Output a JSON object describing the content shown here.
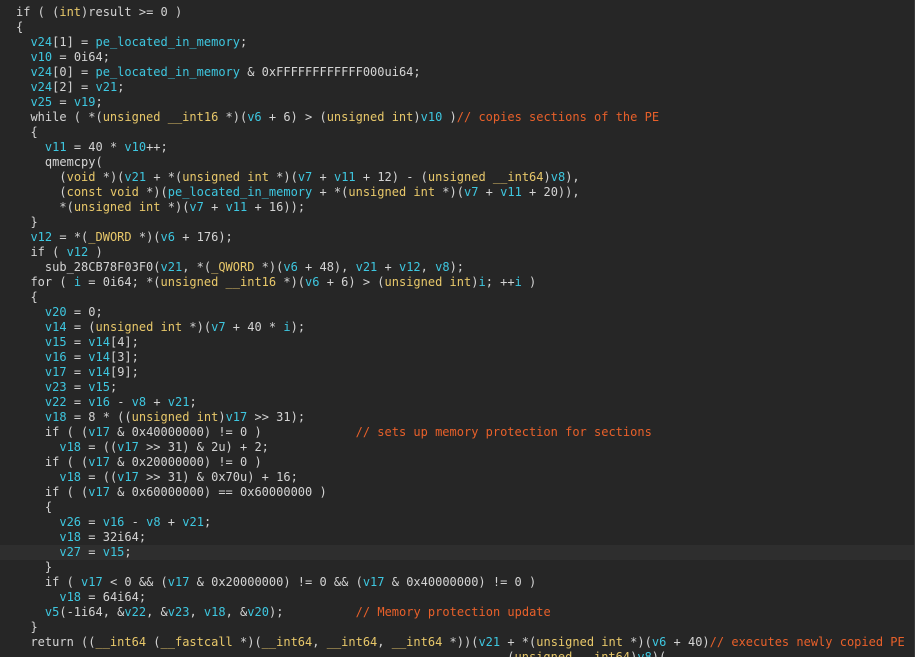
{
  "colors": {
    "background": "#262626",
    "current_line": "#2e2e2e",
    "plain": "#d4d4d4",
    "variable": "#3ec7e0",
    "type": "#e8c86a",
    "comment": "#e8602a"
  },
  "current_line_index": 36,
  "lines": [
    {
      "indent": 0,
      "tokens": [
        [
          "p",
          "if ( ("
        ],
        [
          "t",
          "int"
        ],
        [
          "p",
          ")result >= 0 )"
        ]
      ]
    },
    {
      "indent": 0,
      "tokens": [
        [
          "p",
          "{"
        ]
      ]
    },
    {
      "indent": 1,
      "tokens": [
        [
          "v",
          "v24"
        ],
        [
          "p",
          "[1] = "
        ],
        [
          "v",
          "pe_located_in_memory"
        ],
        [
          "p",
          ";"
        ]
      ]
    },
    {
      "indent": 1,
      "tokens": [
        [
          "v",
          "v10"
        ],
        [
          "p",
          " = 0i64;"
        ]
      ]
    },
    {
      "indent": 1,
      "tokens": [
        [
          "v",
          "v24"
        ],
        [
          "p",
          "[0] = "
        ],
        [
          "v",
          "pe_located_in_memory"
        ],
        [
          "p",
          " & 0xFFFFFFFFFFFF000ui64;"
        ]
      ]
    },
    {
      "indent": 1,
      "tokens": [
        [
          "v",
          "v24"
        ],
        [
          "p",
          "[2] = "
        ],
        [
          "v",
          "v21"
        ],
        [
          "p",
          ";"
        ]
      ]
    },
    {
      "indent": 1,
      "tokens": [
        [
          "v",
          "v25"
        ],
        [
          "p",
          " = "
        ],
        [
          "v",
          "v19"
        ],
        [
          "p",
          ";"
        ]
      ]
    },
    {
      "indent": 1,
      "tokens": [
        [
          "p",
          "while ( *("
        ],
        [
          "t",
          "unsigned __int16"
        ],
        [
          "p",
          " *)("
        ],
        [
          "v",
          "v6"
        ],
        [
          "p",
          " + 6) > ("
        ],
        [
          "t",
          "unsigned int"
        ],
        [
          "p",
          ")"
        ],
        [
          "v",
          "v10"
        ],
        [
          "p",
          " )"
        ],
        [
          "c",
          "// copies sections of the PE"
        ]
      ]
    },
    {
      "indent": 1,
      "tokens": [
        [
          "p",
          "{"
        ]
      ]
    },
    {
      "indent": 2,
      "tokens": [
        [
          "v",
          "v11"
        ],
        [
          "p",
          " = 40 * "
        ],
        [
          "v",
          "v10"
        ],
        [
          "p",
          "++;"
        ]
      ]
    },
    {
      "indent": 2,
      "tokens": [
        [
          "p",
          "qmemcpy("
        ]
      ]
    },
    {
      "indent": 3,
      "tokens": [
        [
          "p",
          "("
        ],
        [
          "t",
          "void"
        ],
        [
          "p",
          " *)("
        ],
        [
          "v",
          "v21"
        ],
        [
          "p",
          " + *("
        ],
        [
          "t",
          "unsigned int"
        ],
        [
          "p",
          " *)("
        ],
        [
          "v",
          "v7"
        ],
        [
          "p",
          " + "
        ],
        [
          "v",
          "v11"
        ],
        [
          "p",
          " + 12) - ("
        ],
        [
          "t",
          "unsigned __int64"
        ],
        [
          "p",
          ")"
        ],
        [
          "v",
          "v8"
        ],
        [
          "p",
          "),"
        ]
      ]
    },
    {
      "indent": 3,
      "tokens": [
        [
          "p",
          "("
        ],
        [
          "t",
          "const void"
        ],
        [
          "p",
          " *)("
        ],
        [
          "v",
          "pe_located_in_memory"
        ],
        [
          "p",
          " + *("
        ],
        [
          "t",
          "unsigned int"
        ],
        [
          "p",
          " *)("
        ],
        [
          "v",
          "v7"
        ],
        [
          "p",
          " + "
        ],
        [
          "v",
          "v11"
        ],
        [
          "p",
          " + 20)),"
        ]
      ]
    },
    {
      "indent": 3,
      "tokens": [
        [
          "p",
          "*("
        ],
        [
          "t",
          "unsigned int"
        ],
        [
          "p",
          " *)("
        ],
        [
          "v",
          "v7"
        ],
        [
          "p",
          " + "
        ],
        [
          "v",
          "v11"
        ],
        [
          "p",
          " + 16));"
        ]
      ]
    },
    {
      "indent": 1,
      "tokens": [
        [
          "p",
          "}"
        ]
      ]
    },
    {
      "indent": 1,
      "tokens": [
        [
          "v",
          "v12"
        ],
        [
          "p",
          " = *("
        ],
        [
          "t",
          "_DWORD"
        ],
        [
          "p",
          " *)("
        ],
        [
          "v",
          "v6"
        ],
        [
          "p",
          " + 176);"
        ]
      ]
    },
    {
      "indent": 1,
      "tokens": [
        [
          "p",
          "if ( "
        ],
        [
          "v",
          "v12"
        ],
        [
          "p",
          " )"
        ]
      ]
    },
    {
      "indent": 2,
      "tokens": [
        [
          "p",
          "sub_28CB78F03F0("
        ],
        [
          "v",
          "v21"
        ],
        [
          "p",
          ", *("
        ],
        [
          "t",
          "_QWORD"
        ],
        [
          "p",
          " *)("
        ],
        [
          "v",
          "v6"
        ],
        [
          "p",
          " + 48), "
        ],
        [
          "v",
          "v21"
        ],
        [
          "p",
          " + "
        ],
        [
          "v",
          "v12"
        ],
        [
          "p",
          ", "
        ],
        [
          "v",
          "v8"
        ],
        [
          "p",
          ");"
        ]
      ]
    },
    {
      "indent": 1,
      "tokens": [
        [
          "p",
          "for ( "
        ],
        [
          "v",
          "i"
        ],
        [
          "p",
          " = 0i64; *("
        ],
        [
          "t",
          "unsigned __int16"
        ],
        [
          "p",
          " *)("
        ],
        [
          "v",
          "v6"
        ],
        [
          "p",
          " + 6) > ("
        ],
        [
          "t",
          "unsigned int"
        ],
        [
          "p",
          ")"
        ],
        [
          "v",
          "i"
        ],
        [
          "p",
          "; ++"
        ],
        [
          "v",
          "i"
        ],
        [
          "p",
          " )"
        ]
      ]
    },
    {
      "indent": 1,
      "tokens": [
        [
          "p",
          "{"
        ]
      ]
    },
    {
      "indent": 2,
      "tokens": [
        [
          "v",
          "v20"
        ],
        [
          "p",
          " = 0;"
        ]
      ]
    },
    {
      "indent": 2,
      "tokens": [
        [
          "v",
          "v14"
        ],
        [
          "p",
          " = ("
        ],
        [
          "t",
          "unsigned int"
        ],
        [
          "p",
          " *)("
        ],
        [
          "v",
          "v7"
        ],
        [
          "p",
          " + 40 * "
        ],
        [
          "v",
          "i"
        ],
        [
          "p",
          ");"
        ]
      ]
    },
    {
      "indent": 2,
      "tokens": [
        [
          "v",
          "v15"
        ],
        [
          "p",
          " = "
        ],
        [
          "v",
          "v14"
        ],
        [
          "p",
          "[4];"
        ]
      ]
    },
    {
      "indent": 2,
      "tokens": [
        [
          "v",
          "v16"
        ],
        [
          "p",
          " = "
        ],
        [
          "v",
          "v14"
        ],
        [
          "p",
          "[3];"
        ]
      ]
    },
    {
      "indent": 2,
      "tokens": [
        [
          "v",
          "v17"
        ],
        [
          "p",
          " = "
        ],
        [
          "v",
          "v14"
        ],
        [
          "p",
          "[9];"
        ]
      ]
    },
    {
      "indent": 2,
      "tokens": [
        [
          "v",
          "v23"
        ],
        [
          "p",
          " = "
        ],
        [
          "v",
          "v15"
        ],
        [
          "p",
          ";"
        ]
      ]
    },
    {
      "indent": 2,
      "tokens": [
        [
          "v",
          "v22"
        ],
        [
          "p",
          " = "
        ],
        [
          "v",
          "v16"
        ],
        [
          "p",
          " - "
        ],
        [
          "v",
          "v8"
        ],
        [
          "p",
          " + "
        ],
        [
          "v",
          "v21"
        ],
        [
          "p",
          ";"
        ]
      ]
    },
    {
      "indent": 2,
      "tokens": [
        [
          "v",
          "v18"
        ],
        [
          "p",
          " = 8 * (("
        ],
        [
          "t",
          "unsigned int"
        ],
        [
          "p",
          ")"
        ],
        [
          "v",
          "v17"
        ],
        [
          "p",
          " >> 31);"
        ]
      ]
    },
    {
      "indent": 2,
      "tokens": [
        [
          "p",
          "if ( ("
        ],
        [
          "v",
          "v17"
        ],
        [
          "p",
          " & 0x40000000) != 0 )             "
        ],
        [
          "c",
          "// sets up memory protection for sections"
        ]
      ]
    },
    {
      "indent": 3,
      "tokens": [
        [
          "v",
          "v18"
        ],
        [
          "p",
          " = (("
        ],
        [
          "v",
          "v17"
        ],
        [
          "p",
          " >> 31) & 2u) + 2;"
        ]
      ]
    },
    {
      "indent": 2,
      "tokens": [
        [
          "p",
          "if ( ("
        ],
        [
          "v",
          "v17"
        ],
        [
          "p",
          " & 0x20000000) != 0 )"
        ]
      ]
    },
    {
      "indent": 3,
      "tokens": [
        [
          "v",
          "v18"
        ],
        [
          "p",
          " = (("
        ],
        [
          "v",
          "v17"
        ],
        [
          "p",
          " >> 31) & 0x70u) + 16;"
        ]
      ]
    },
    {
      "indent": 2,
      "tokens": [
        [
          "p",
          "if ( ("
        ],
        [
          "v",
          "v17"
        ],
        [
          "p",
          " & 0x60000000) == 0x60000000 )"
        ]
      ]
    },
    {
      "indent": 2,
      "tokens": [
        [
          "p",
          "{"
        ]
      ]
    },
    {
      "indent": 3,
      "tokens": [
        [
          "v",
          "v26"
        ],
        [
          "p",
          " = "
        ],
        [
          "v",
          "v16"
        ],
        [
          "p",
          " - "
        ],
        [
          "v",
          "v8"
        ],
        [
          "p",
          " + "
        ],
        [
          "v",
          "v21"
        ],
        [
          "p",
          ";"
        ]
      ]
    },
    {
      "indent": 3,
      "tokens": [
        [
          "v",
          "v18"
        ],
        [
          "p",
          " = 32i64;"
        ]
      ]
    },
    {
      "indent": 3,
      "tokens": [
        [
          "v",
          "v27"
        ],
        [
          "p",
          " = "
        ],
        [
          "v",
          "v15"
        ],
        [
          "p",
          ";"
        ]
      ]
    },
    {
      "indent": 2,
      "tokens": [
        [
          "p",
          "}"
        ]
      ]
    },
    {
      "indent": 2,
      "tokens": [
        [
          "p",
          "if ( "
        ],
        [
          "v",
          "v17"
        ],
        [
          "p",
          " < 0 && ("
        ],
        [
          "v",
          "v17"
        ],
        [
          "p",
          " & 0x20000000) != 0 && ("
        ],
        [
          "v",
          "v17"
        ],
        [
          "p",
          " & 0x40000000) != 0 )"
        ]
      ]
    },
    {
      "indent": 3,
      "tokens": [
        [
          "v",
          "v18"
        ],
        [
          "p",
          " = 64i64;"
        ]
      ]
    },
    {
      "indent": 2,
      "tokens": [
        [
          "v",
          "v5"
        ],
        [
          "p",
          "(-1i64, &"
        ],
        [
          "v",
          "v22"
        ],
        [
          "p",
          ", &"
        ],
        [
          "v",
          "v23"
        ],
        [
          "p",
          ", "
        ],
        [
          "v",
          "v18"
        ],
        [
          "p",
          ", &"
        ],
        [
          "v",
          "v20"
        ],
        [
          "p",
          ");          "
        ],
        [
          "c",
          "// Memory protection update"
        ]
      ]
    },
    {
      "indent": 1,
      "tokens": [
        [
          "p",
          "}"
        ]
      ]
    },
    {
      "indent": 1,
      "tokens": [
        [
          "p",
          "return (("
        ],
        [
          "t",
          "__int64"
        ],
        [
          "p",
          " ("
        ],
        [
          "t",
          "__fastcall"
        ],
        [
          "p",
          " *)("
        ],
        [
          "t",
          "__int64"
        ],
        [
          "p",
          ", "
        ],
        [
          "t",
          "__int64"
        ],
        [
          "p",
          ", "
        ],
        [
          "t",
          "__int64"
        ],
        [
          "p",
          " *))("
        ],
        [
          "v",
          "v21"
        ],
        [
          "p",
          " + *("
        ],
        [
          "t",
          "unsigned int"
        ],
        [
          "p",
          " *)("
        ],
        [
          "v",
          "v6"
        ],
        [
          "p",
          " + 40)"
        ],
        [
          "c",
          "// executes newly copied PE"
        ]
      ]
    },
    {
      "indent": 0,
      "prefix_spaces": 68,
      "tokens": [
        [
          "p",
          "("
        ],
        [
          "t",
          "unsigned __int64"
        ],
        [
          "p",
          ")"
        ],
        [
          "v",
          "v8"
        ],
        [
          "p",
          ")("
        ]
      ]
    }
  ]
}
